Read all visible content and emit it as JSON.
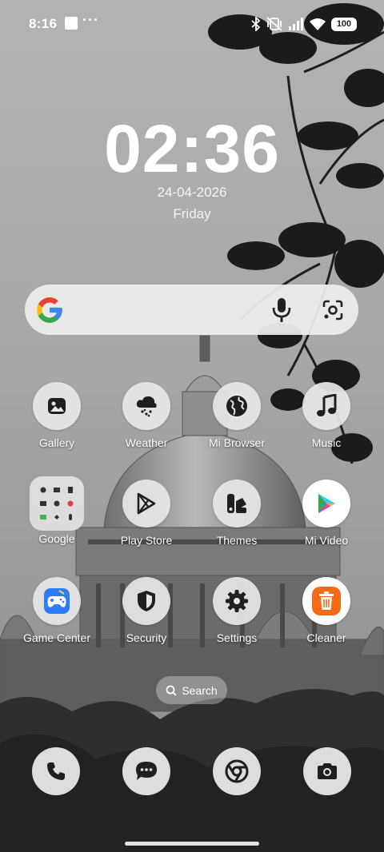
{
  "status_bar": {
    "time": "8:16",
    "more_glyph": "···",
    "battery": "100",
    "icons": [
      "notification-square-icon",
      "bluetooth-icon",
      "vibrate-off-icon",
      "signal-icon",
      "wifi-icon",
      "battery-icon"
    ]
  },
  "clock": {
    "time": "02:36",
    "date": "24-04-2026",
    "day": "Friday"
  },
  "search_widget": {
    "icons": [
      "google-logo-icon",
      "microphone-icon",
      "google-lens-icon"
    ]
  },
  "apps": [
    {
      "label": "Gallery",
      "icon": "gallery-icon"
    },
    {
      "label": "Weather",
      "icon": "weather-icon"
    },
    {
      "label": "Mi Browser",
      "icon": "globe-icon"
    },
    {
      "label": "Music",
      "icon": "music-note-icon"
    },
    {
      "label": "Google",
      "icon": "folder-icon"
    },
    {
      "label": "Play Store",
      "icon": "play-store-icon"
    },
    {
      "label": "Themes",
      "icon": "themes-icon"
    },
    {
      "label": "Mi Video",
      "icon": "play-video-icon"
    },
    {
      "label": "Game Center",
      "icon": "gamepad-icon"
    },
    {
      "label": "Security",
      "icon": "shield-icon"
    },
    {
      "label": "Settings",
      "icon": "gear-icon"
    },
    {
      "label": "Cleaner",
      "icon": "trash-icon"
    }
  ],
  "home_search": {
    "label": "Search",
    "icon": "search-icon"
  },
  "dock": [
    {
      "icon": "phone-icon"
    },
    {
      "icon": "messages-icon"
    },
    {
      "icon": "chrome-icon"
    },
    {
      "icon": "camera-icon"
    }
  ],
  "colors": {
    "google_blue": "#4285F4",
    "google_red": "#EA4335",
    "google_yellow": "#FBBC05",
    "google_green": "#34A853",
    "game_center_blue": "#2d7cf6",
    "cleaner_orange": "#f56a16"
  }
}
